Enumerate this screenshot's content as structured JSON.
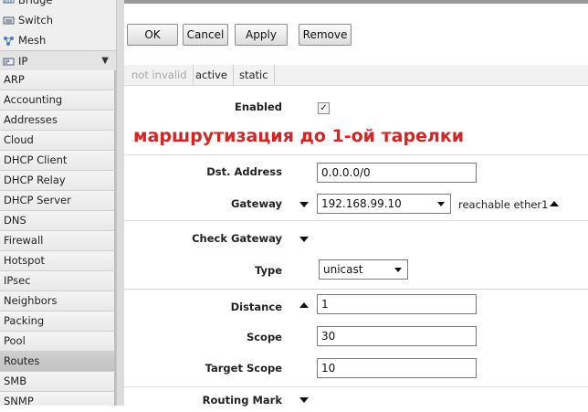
{
  "sidebar": {
    "top_items": [
      {
        "label": "Bridge",
        "icon": "bridge-icon"
      },
      {
        "label": "Switch",
        "icon": "switch-icon"
      },
      {
        "label": "Mesh",
        "icon": "mesh-icon"
      },
      {
        "label": "IP",
        "icon": "ip-icon"
      }
    ],
    "ip_submenu": [
      "ARP",
      "Accounting",
      "Addresses",
      "Cloud",
      "DHCP Client",
      "DHCP Relay",
      "DHCP Server",
      "DNS",
      "Firewall",
      "Hotspot",
      "IPsec",
      "Neighbors",
      "Packing",
      "Pool",
      "Routes",
      "SMB",
      "SNMP"
    ],
    "selected": "Routes"
  },
  "toolbar": {
    "ok_label": "OK",
    "cancel_label": "Cancel",
    "apply_label": "Apply",
    "remove_label": "Remove"
  },
  "status_tabs": [
    "not invalid",
    "active",
    "static"
  ],
  "form": {
    "enabled_label": "Enabled",
    "enabled_checked": true,
    "annotation": "маршрутизация до 1-ой тарелки",
    "dst_address_label": "Dst. Address",
    "dst_address_value": "0.0.0.0/0",
    "gateway_label": "Gateway",
    "gateway_value": "192.168.99.10",
    "gateway_status": "reachable ether1",
    "check_gateway_label": "Check Gateway",
    "type_label": "Type",
    "type_value": "unicast",
    "distance_label": "Distance",
    "distance_value": "1",
    "scope_label": "Scope",
    "scope_value": "30",
    "target_scope_label": "Target Scope",
    "target_scope_value": "10",
    "routing_mark_label": "Routing Mark"
  },
  "colors": {
    "annotation": "#d42424",
    "selected_item": "#c6c6c6",
    "sidebar_bg": "#efefef"
  }
}
